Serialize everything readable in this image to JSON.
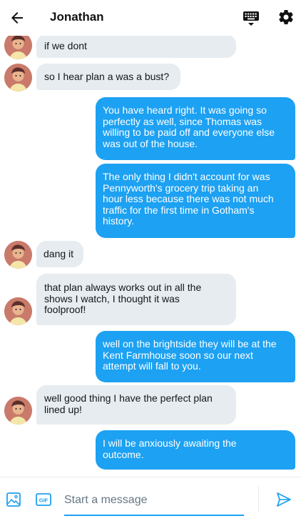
{
  "header": {
    "title": "Jonathan",
    "back_icon": "arrow-left-icon",
    "keyboard_icon": "keyboard-icon",
    "settings_icon": "gear-icon"
  },
  "colors": {
    "accent": "#1da1f2",
    "incoming_bubble": "#e6ecf0",
    "incoming_text": "#14171a",
    "outgoing_text": "#ffffff"
  },
  "messages": [
    {
      "direction": "incoming",
      "lines": [
        "if we dont"
      ]
    },
    {
      "direction": "incoming",
      "lines": [
        "so I hear plan a was a bust?"
      ]
    },
    {
      "direction": "outgoing",
      "lines": [
        "You have heard right. It was going so",
        "perfectly as well, since Thomas was",
        "willing to be paid off and everyone else",
        "was out of the house."
      ]
    },
    {
      "direction": "outgoing",
      "lines": [
        "The only thing I didn't account for was",
        "Pennyworth's grocery trip taking an",
        "hour less because there was not much",
        "traffic for the first time in Gotham's",
        "history."
      ]
    },
    {
      "direction": "incoming",
      "lines": [
        "dang it"
      ]
    },
    {
      "direction": "incoming",
      "lines": [
        "that plan always works out in all the",
        "shows I watch, I thought it was",
        "foolproof!"
      ]
    },
    {
      "direction": "outgoing",
      "lines": [
        "well on the brightside they will be at the",
        "Kent Farmhouse soon so our next",
        "attempt will fall to you."
      ]
    },
    {
      "direction": "incoming",
      "lines": [
        "well good thing I have the perfect plan",
        "lined up!"
      ]
    },
    {
      "direction": "outgoing",
      "lines": [
        "I will be anxiously awaiting the",
        "outcome."
      ]
    }
  ],
  "composer": {
    "placeholder": "Start a message",
    "value": "",
    "image_icon": "image-icon",
    "gif_label": "GIF",
    "send_icon": "send-icon"
  }
}
